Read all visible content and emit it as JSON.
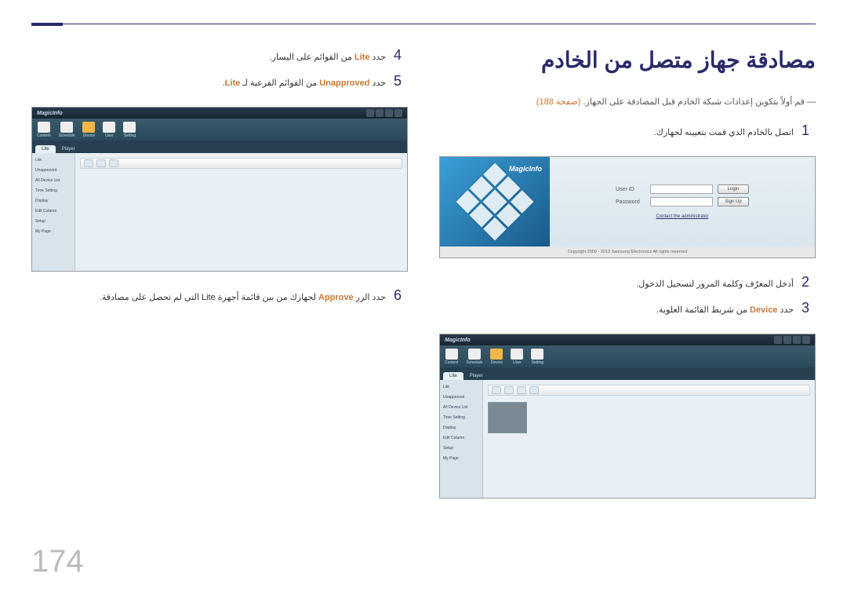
{
  "page_number": "174",
  "heading": "مصادقة جهاز متصل من الخادم",
  "note_prefix": "― قم أولاً بتكوين إعدادات شبكة الخادم قبل المصادقة على الجهاز. ",
  "note_link": "(صفحة 188)",
  "steps_right": [
    {
      "num": "1",
      "text": "اتصل بالخادم الذي قمت بتعيينه لجهازك."
    },
    {
      "num": "2",
      "text": "أدخل المعرّف وكلمة المرور لتسجيل الدخول."
    },
    {
      "num": "3",
      "pre": "حدد ",
      "hl": "Device",
      "post": " من شريط القائمة العلوية."
    }
  ],
  "steps_left": [
    {
      "num": "4",
      "pre": "حدد ",
      "hl": "Lite",
      "post": " من القوائم على اليسار."
    },
    {
      "num": "5",
      "pre": "حدد ",
      "hl": "Unapproved",
      "post": " من القوائم الفرعية لـ ",
      "hl2": "Lite",
      "post2": "."
    },
    {
      "num": "6",
      "pre": "حدد الزر ",
      "hl": "Approve",
      "post": " لجهازك من بين قائمة أجهزة Lite التي لم تحصل على مصادقة."
    }
  ],
  "login": {
    "brand": "MagicInfo",
    "userid_label": "User ID",
    "password_label": "Password",
    "login_btn": "Login",
    "signup_btn": "Sign Up",
    "contact_link": "Contact the administrator",
    "copyright": "Copyright 2009 - 2013 Samsung Electronics All rights reserved"
  },
  "app": {
    "brand": "MagicInfo",
    "nav": [
      "Content",
      "Schedule",
      "Device",
      "User",
      "Setting"
    ],
    "tabs_main": [
      "Lite",
      "Player"
    ],
    "sidebar_main": [
      "Lite",
      "Unapproved",
      "All Device List",
      "Time Setting",
      "Display",
      "Edit Column",
      "Setup",
      "My Page"
    ],
    "tab_device_label": "Device"
  }
}
